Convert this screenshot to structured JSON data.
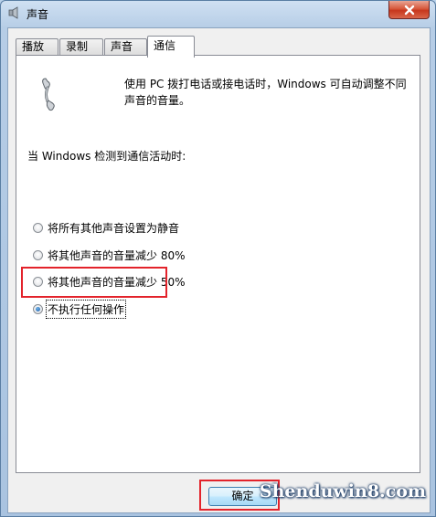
{
  "window": {
    "title": "声音",
    "close_icon": "close-icon"
  },
  "tabs": [
    {
      "label": "播放"
    },
    {
      "label": "录制"
    },
    {
      "label": "声音"
    },
    {
      "label": "通信",
      "active": true
    }
  ],
  "communications": {
    "phone_icon": "phone-handset-icon",
    "description": "使用 PC 拨打电话或接电话时，Windows 可自动调整不同声音的音量。",
    "when_label": "当 Windows 检测到通信活动时:",
    "options": [
      {
        "label": "将所有其他声音设置为静音",
        "checked": false
      },
      {
        "label": "将其他声音的音量减少 80%",
        "checked": false
      },
      {
        "label": "将其他声音的音量减少 50%",
        "checked": false
      },
      {
        "label": "不执行任何操作",
        "checked": true
      }
    ]
  },
  "buttons": {
    "ok_label": "确定"
  },
  "watermark": "Shenduwin8.com",
  "colors": {
    "highlight": "#e3232b",
    "selected_radio": "#1a5aa8",
    "close_button": "#c7361d"
  }
}
